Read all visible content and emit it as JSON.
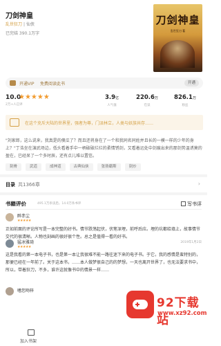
{
  "book": {
    "title": "刀剑神皇",
    "author": "乱世狂刀",
    "category": "| 仙侠",
    "status_words": "已完结 390.1万字",
    "cover_title": "刀剑神皇",
    "cover_subtitle": "乱世狂刀 著"
  },
  "vip": {
    "badge": "开通VIP",
    "text": "免费阅读此书",
    "button": "开通"
  },
  "stats": {
    "rating": "10.0",
    "stars": "★★★★★",
    "rating_count": "2万+人已评",
    "popularity": {
      "value": "3.9",
      "unit": "亿",
      "label": "人气值"
    },
    "readers": {
      "value": "220.6",
      "unit": "万",
      "label": "在读"
    },
    "fans": {
      "value": "826.1",
      "unit": "万",
      "label": "粉丝"
    }
  },
  "quote": "在这个充斥大陆的世界里，强者为尊，门派林立，人类与妖族共存……",
  "description": "\"刘家郎，这么说来，我真是的傻瓜了？而且还将身在了一个和我同名同姓并且长的一模一样的少年的身上？\"丁浩坐在演武场边，低头看着手中一柄破破烂烂的柔情锈剑，又看着远处中剑痕出来的那剑势温诱莫的盈在，已经呆了一个多时辰，还有点儿难以置信。",
  "tags": [
    "刻骨",
    "武道",
    "成神道",
    "古典仙侠",
    "张扬霸斯",
    "刻炒"
  ],
  "toc": {
    "label": "目录",
    "count": "共1366章",
    "chevron": "›"
  },
  "reviews": {
    "title": "书籍评价",
    "subtitle": "495.1万条读后，14.0万条书评",
    "write": "写书评",
    "items": [
      {
        "name": "醉赤尘",
        "stars": "★★★★★",
        "date": "",
        "text": "正如前面的评论所写是一本完整的好书。情节跌荡起伏，伏笔深埋，前呼后应。埋的坑都给填上，故事情节交代的很清晰。人物也刻画的很好很个性。总之是值得一看的好书。"
      },
      {
        "name": "猛冰雅琦",
        "stars": "★★★★★",
        "date": "2019年1月2日",
        "text": "这是我看的第一本电子书，也是第一本让我很难不能一路往迷下来的电子书。于它，我的感情是蛮特别的，那便已经在一年前了。关于这本书，……本人做梦很自己的的梦想，一天也离开世界了，也无法要求书中，所以，带着狂刀，不多，谁许这就像书中的情景一样……"
      },
      {
        "name": "嗜您吻梓",
        "stars": "",
        "date": "",
        "text": ""
      }
    ]
  },
  "bottom": {
    "shelf": "加入书架"
  },
  "watermark": {
    "name": "92下载站",
    "url": "www.xz92.com"
  }
}
